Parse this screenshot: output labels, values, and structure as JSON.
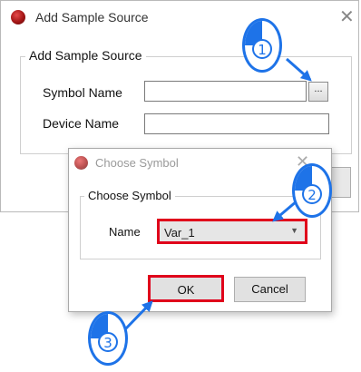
{
  "main_dialog": {
    "title": "Add Sample Source",
    "group_title": "Add Sample Source",
    "symbol_name_label": "Symbol Name",
    "symbol_name_value": "",
    "browse_label": "...",
    "device_name_label": "Device Name",
    "device_name_value": ""
  },
  "choose_dialog": {
    "title": "Choose Symbol",
    "group_title": "Choose Symbol",
    "name_label": "Name",
    "name_value": "Var_1",
    "ok_label": "OK",
    "cancel_label": "Cancel"
  },
  "steps": [
    "1",
    "2",
    "3"
  ],
  "colors": {
    "highlight": "#e0001b",
    "step_blue": "#1e73e8"
  }
}
